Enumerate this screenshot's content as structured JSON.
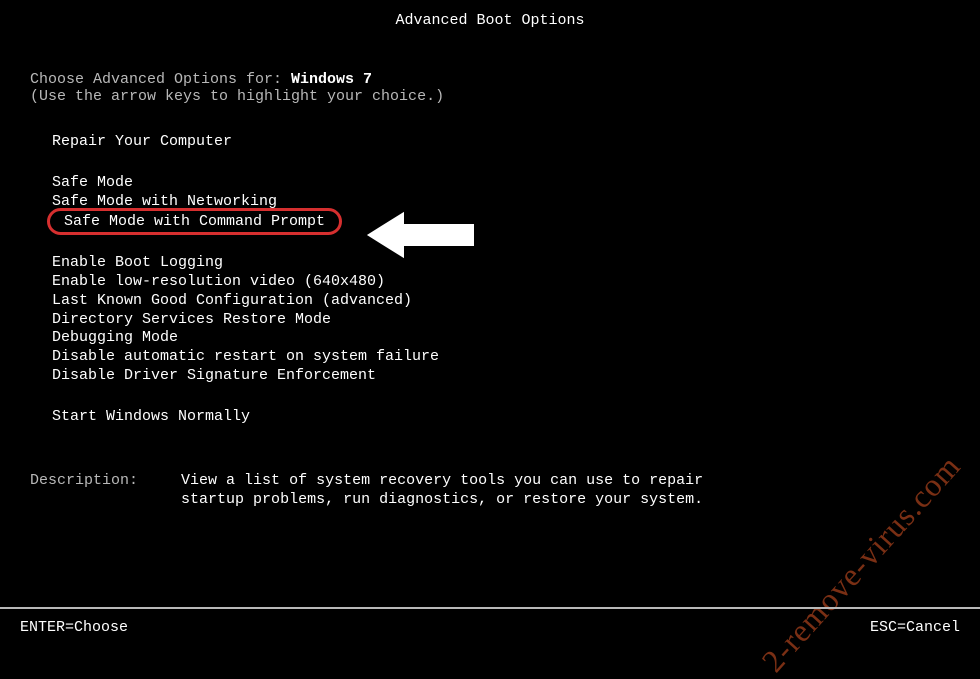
{
  "header": {
    "title": "Advanced Boot Options"
  },
  "prompt": {
    "prefix": "Choose Advanced Options for: ",
    "os": "Windows 7",
    "instruction": "(Use the arrow keys to highlight your choice.)"
  },
  "groups": {
    "repair": {
      "item": "Repair Your Computer"
    },
    "safe": {
      "item1": "Safe Mode",
      "item2": "Safe Mode with Networking",
      "item3": "Safe Mode with Command Prompt"
    },
    "advanced": {
      "item1": "Enable Boot Logging",
      "item2": "Enable low-resolution video (640x480)",
      "item3": "Last Known Good Configuration (advanced)",
      "item4": "Directory Services Restore Mode",
      "item5": "Debugging Mode",
      "item6": "Disable automatic restart on system failure",
      "item7": "Disable Driver Signature Enforcement"
    },
    "normal": {
      "item": "Start Windows Normally"
    }
  },
  "description": {
    "label": "Description:",
    "text": "View a list of system recovery tools you can use to repair startup problems, run diagnostics, or restore your system."
  },
  "footer": {
    "enter": "ENTER=Choose",
    "esc": "ESC=Cancel"
  },
  "watermark": "2-remove-virus.com"
}
